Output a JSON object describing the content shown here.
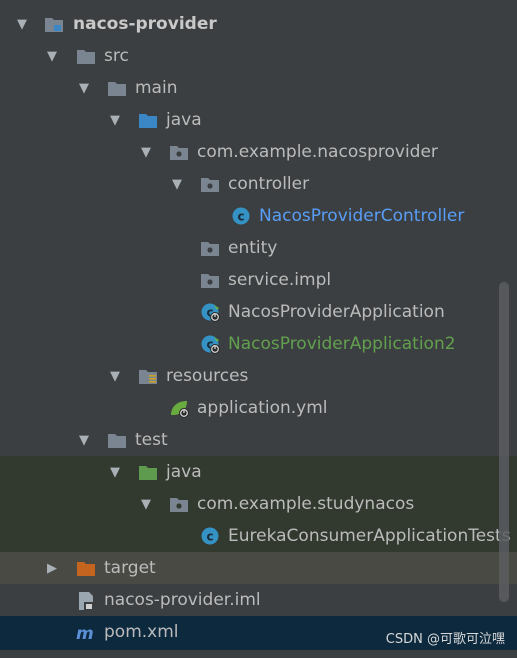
{
  "tree": {
    "items": [
      {
        "label": "nacos-provider"
      },
      {
        "label": "src"
      },
      {
        "label": "main"
      },
      {
        "label": "java"
      },
      {
        "label": "com.example.nacosprovider"
      },
      {
        "label": "controller"
      },
      {
        "label": "NacosProviderController"
      },
      {
        "label": "entity"
      },
      {
        "label": "service.impl"
      },
      {
        "label": "NacosProviderApplication"
      },
      {
        "label": "NacosProviderApplication2"
      },
      {
        "label": "resources"
      },
      {
        "label": "application.yml"
      },
      {
        "label": "test"
      },
      {
        "label": "java"
      },
      {
        "label": "com.example.studynacos"
      },
      {
        "label": "EurekaConsumerApplicationTests"
      },
      {
        "label": "target"
      },
      {
        "label": "nacos-provider.iml"
      },
      {
        "label": "pom.xml"
      }
    ]
  },
  "watermark": "CSDN @可歌可泣嘿",
  "colors": {
    "background": "#3c3f41",
    "folder": "#7a8591",
    "source_folder": "#3b86c4",
    "test_folder": "#5f9b4e",
    "excluded_folder": "#c5641f",
    "class_icon": "#3592c4",
    "link_blue": "#589df6",
    "modified_green": "#62a04e",
    "selected": "#0d293e"
  }
}
